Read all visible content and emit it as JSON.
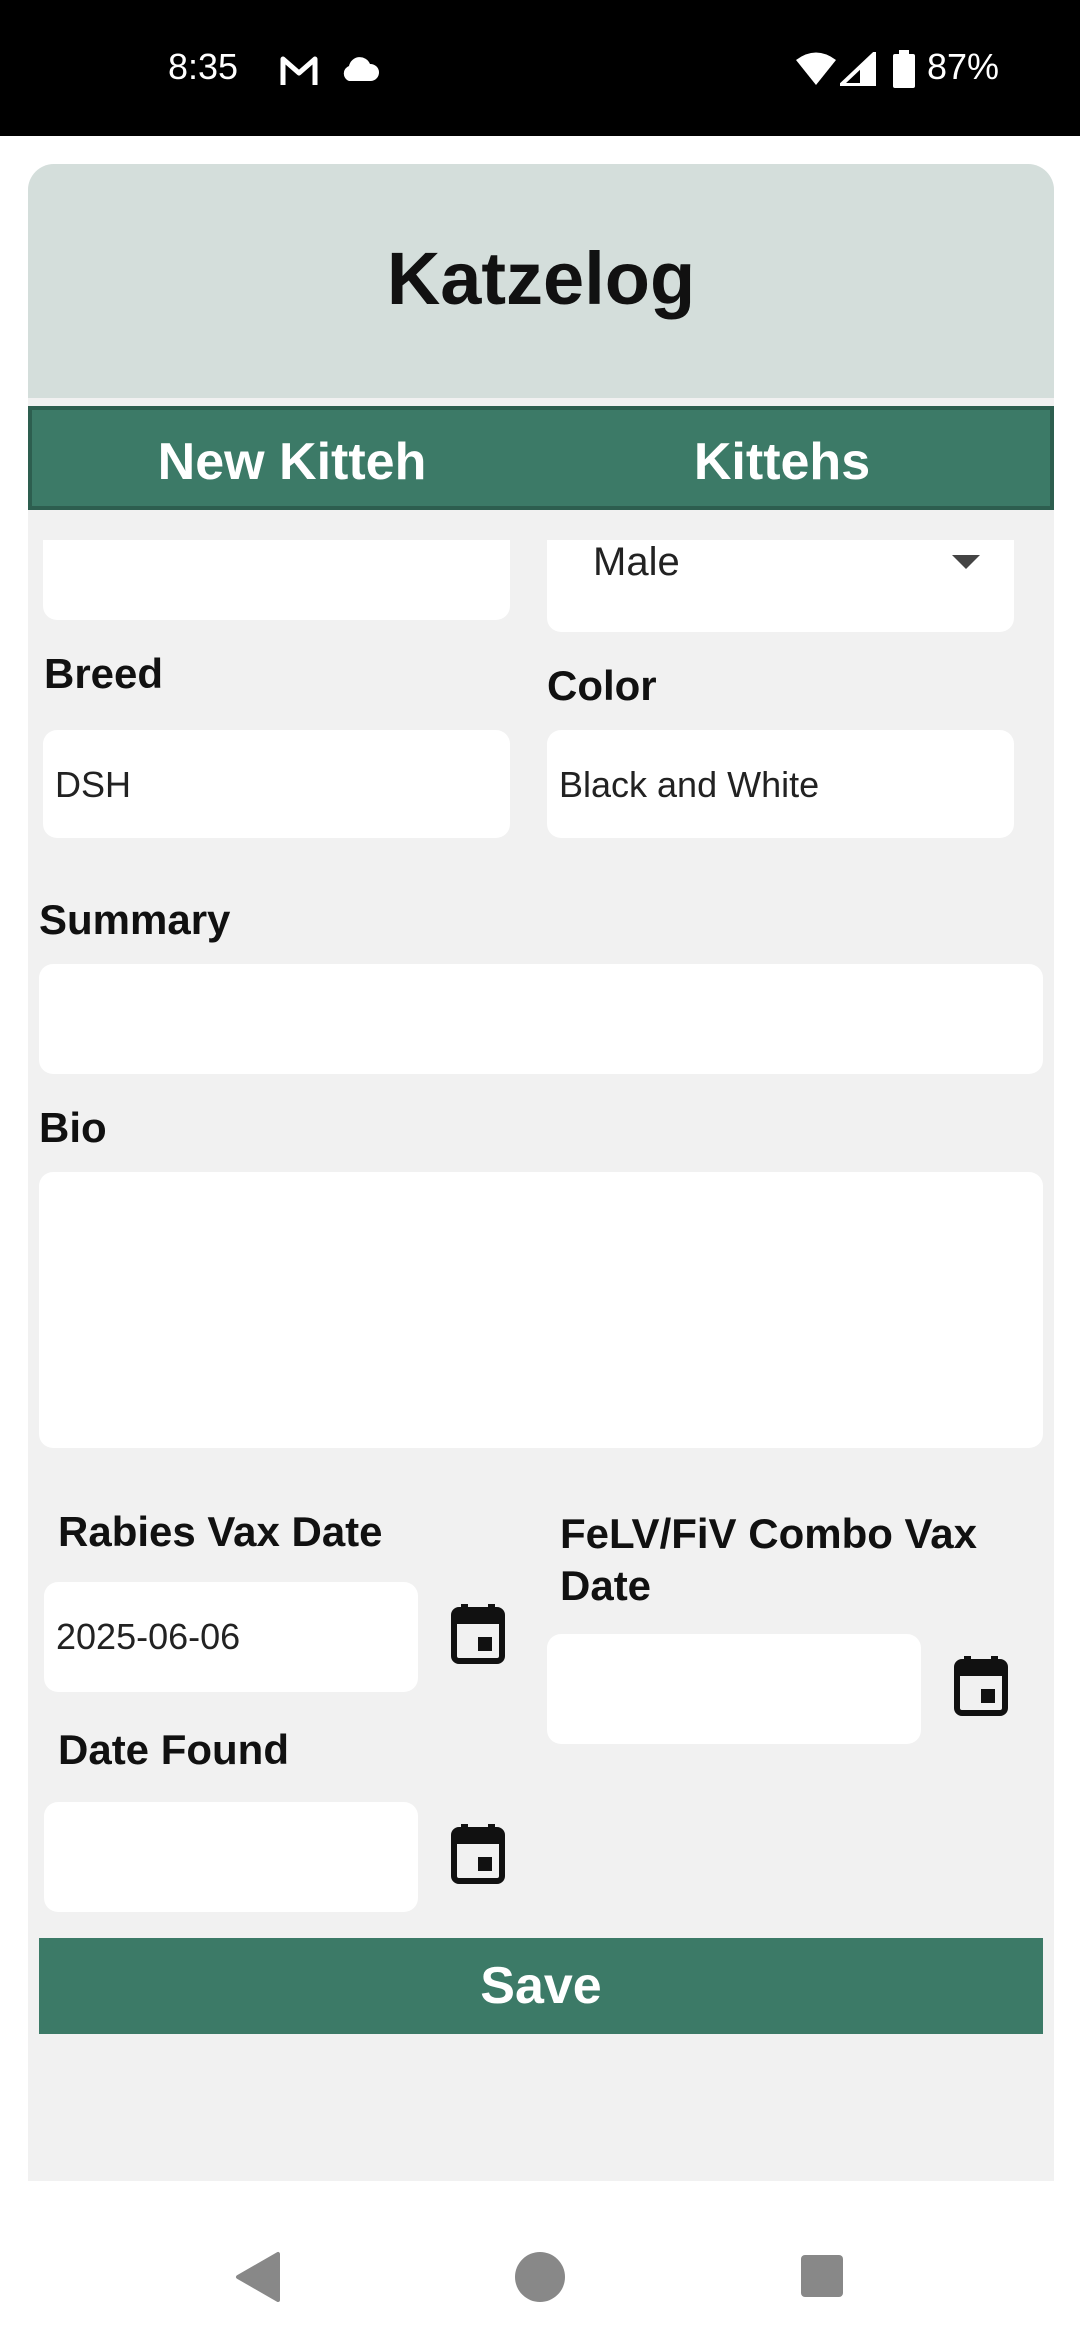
{
  "status_bar": {
    "time": "8:35",
    "battery": "87%",
    "icons": [
      "gmail-icon",
      "cloud-icon",
      "wifi-icon",
      "signal-icon",
      "battery-icon"
    ]
  },
  "app": {
    "title": "Katzelog",
    "tabs": [
      {
        "label": "New Kitteh"
      },
      {
        "label": "Kittehs"
      }
    ]
  },
  "form": {
    "sex": {
      "value": "Male"
    },
    "breed": {
      "label": "Breed",
      "value": "DSH"
    },
    "color": {
      "label": "Color",
      "value": "Black and White"
    },
    "summary": {
      "label": "Summary",
      "value": ""
    },
    "bio": {
      "label": "Bio",
      "value": ""
    },
    "rabies": {
      "label": "Rabies Vax Date",
      "value": "2025-06-06"
    },
    "felv": {
      "label": "FeLV/FiV Combo Vax Date",
      "value": ""
    },
    "date_found": {
      "label": "Date Found",
      "value": ""
    },
    "save_label": "Save"
  },
  "colors": {
    "accent": "#3c7a67",
    "header_bg": "#d4dedb",
    "form_bg": "#f1f1f1"
  }
}
